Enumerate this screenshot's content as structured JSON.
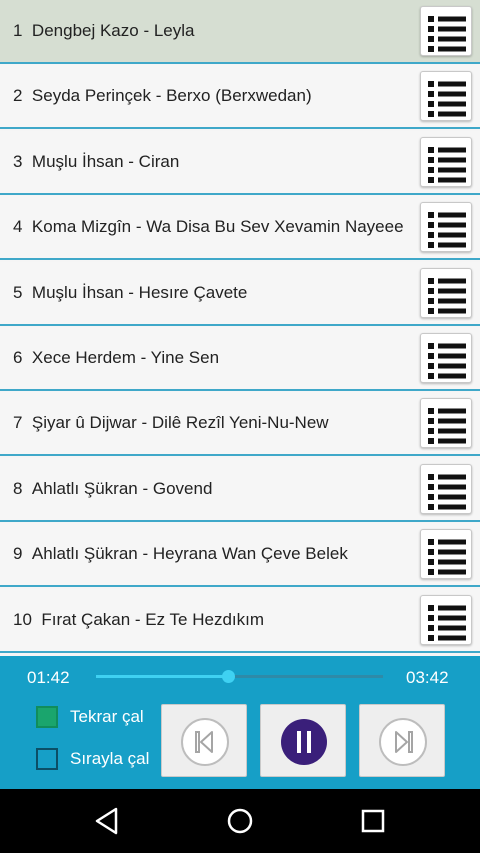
{
  "playlist": [
    {
      "number": "1",
      "title": "Dengbej Kazo - Leyla",
      "selected": true
    },
    {
      "number": "2",
      "title": "Seyda Perinçek - Berxo (Berxwedan)",
      "selected": false
    },
    {
      "number": "3",
      "title": "Muşlu İhsan - Ciran",
      "selected": false
    },
    {
      "number": "4",
      "title": "Koma Mizgîn - Wa Disa Bu Sev Xevamin Nayeee",
      "selected": false
    },
    {
      "number": "5",
      "title": "Muşlu İhsan - Hesıre Çavete",
      "selected": false
    },
    {
      "number": "6",
      "title": "Xece Herdem - Yine Sen",
      "selected": false
    },
    {
      "number": "7",
      "title": "Şiyar û Dijwar - Dilê Rezîl Yeni-Nu-New",
      "selected": false
    },
    {
      "number": "8",
      "title": "Ahlatlı Şükran - Govend",
      "selected": false
    },
    {
      "number": "9",
      "title": "Ahlatlı Şükran - Heyrana Wan Çeve Belek",
      "selected": false
    },
    {
      "number": "10",
      "title": "Fırat Çakan - Ez Te Hezdıkım",
      "selected": false
    }
  ],
  "player": {
    "current_time": "01:42",
    "total_time": "03:42",
    "progress": 0.46,
    "repeat_label": "Tekrar çal",
    "repeat_checked": true,
    "sequential_label": "Sırayla çal",
    "sequential_checked": false,
    "prev_icon": "skip-previous-icon",
    "pause_icon": "pause-icon",
    "next_icon": "skip-next-icon",
    "menu_icon": "list-menu-icon"
  },
  "navbar": {
    "back_icon": "back-triangle-icon",
    "home_icon": "home-circle-icon",
    "recents_icon": "recents-square-icon"
  },
  "colors": {
    "accent": "#169fc7",
    "divider": "#3fa8c9",
    "seek_fill": "#3fd1f2",
    "checkbox_on": "#1aa56d",
    "pause_button": "#3a1f7a",
    "selected_row": "#d6ded2"
  }
}
